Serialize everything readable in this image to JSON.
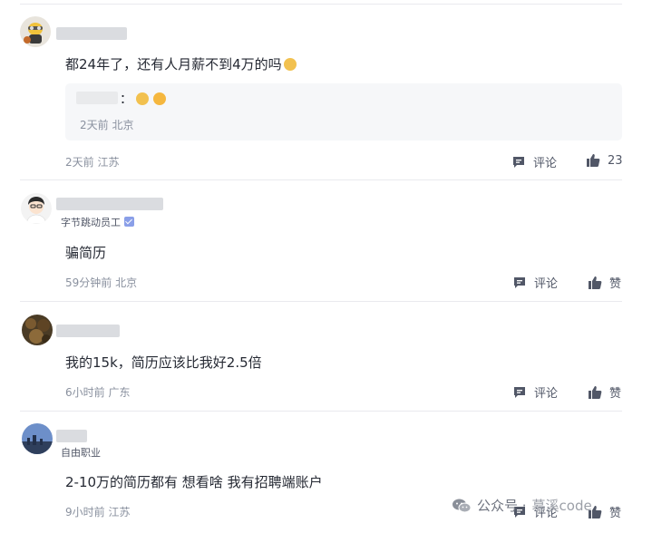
{
  "comments": [
    {
      "content": "都24年了，还有人月薪不到4万的吗",
      "reply": {
        "text": "：",
        "meta": "2天前 北京"
      },
      "meta": "2天前 江苏",
      "comment_label": "评论",
      "like_label": "23"
    },
    {
      "role": "字节跳动员工",
      "content": "骗简历",
      "meta": "59分钟前 北京",
      "comment_label": "评论",
      "like_label": "赞"
    },
    {
      "content": "我的15k，简历应该比我好2.5倍",
      "meta": "6小时前 广东",
      "comment_label": "评论",
      "like_label": "赞"
    },
    {
      "role": "自由职业",
      "content": "2-10万的简历都有 想看啥 我有招聘端账户",
      "meta": "9小时前 江苏",
      "comment_label": "评论",
      "like_label": "赞"
    }
  ],
  "watermark": {
    "prefix": "公众号 ·",
    "name": "慕溪code"
  }
}
